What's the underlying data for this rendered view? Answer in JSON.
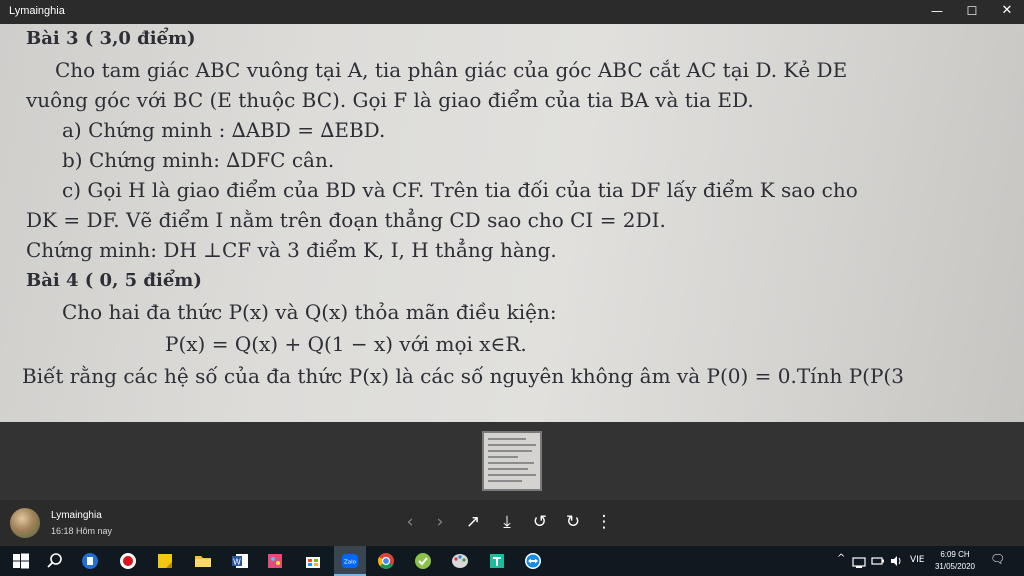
{
  "window": {
    "title": "Lymainghia",
    "minimize": "—",
    "maximize": "☐",
    "close": "✕"
  },
  "document_lines": [
    "Bài 3 ( 3,0 điểm)",
    "Cho tam giác ABC vuông tại A, tia phân giác của góc ABC cắt AC tại D. Kẻ DE",
    "vuông góc với BC (E thuộc BC). Gọi F là giao điểm của tia BA và tia ED.",
    "a) Chứng minh : ∆ABD = ∆EBD.",
    "b) Chứng minh: ∆DFC cân.",
    "c) Gọi H là giao điểm của BD và CF. Trên tia đối của tia DF lấy điểm K sao cho",
    "DK = DF. Vẽ điểm I nằm trên đoạn thẳng CD sao cho CI = 2DI.",
    "Chứng minh: DH ⊥CF và 3 điểm K, I, H thẳng hàng.",
    "Bài 4 ( 0, 5 điểm)",
    "Cho hai đa thức P(x) và Q(x) thỏa mãn điều kiện:",
    "P(x) = Q(x) + Q(1 − x) với mọi x∈R.",
    "Biết rằng các hệ số của đa thức P(x) là các số nguyên không âm và P(0) = 0.Tính P(P(3"
  ],
  "sender": {
    "name": "Lymainghia",
    "time": "16:18 Hôm nay"
  },
  "toolbar": {
    "prev": "‹",
    "next": "›",
    "share": "↗",
    "download": "⤓",
    "rotate_left": "↺",
    "rotate_right": "↻",
    "more": "⋮"
  },
  "tray": {
    "chevron": "^",
    "language": "VIE",
    "time": "6:09 CH",
    "date": "31/05/2020",
    "notification": "🗨"
  },
  "colors": {
    "titlebar": "#2b2b2b",
    "paper": "#d6d5d3",
    "ink": "#2d2e36",
    "taskbar": "#101820"
  }
}
